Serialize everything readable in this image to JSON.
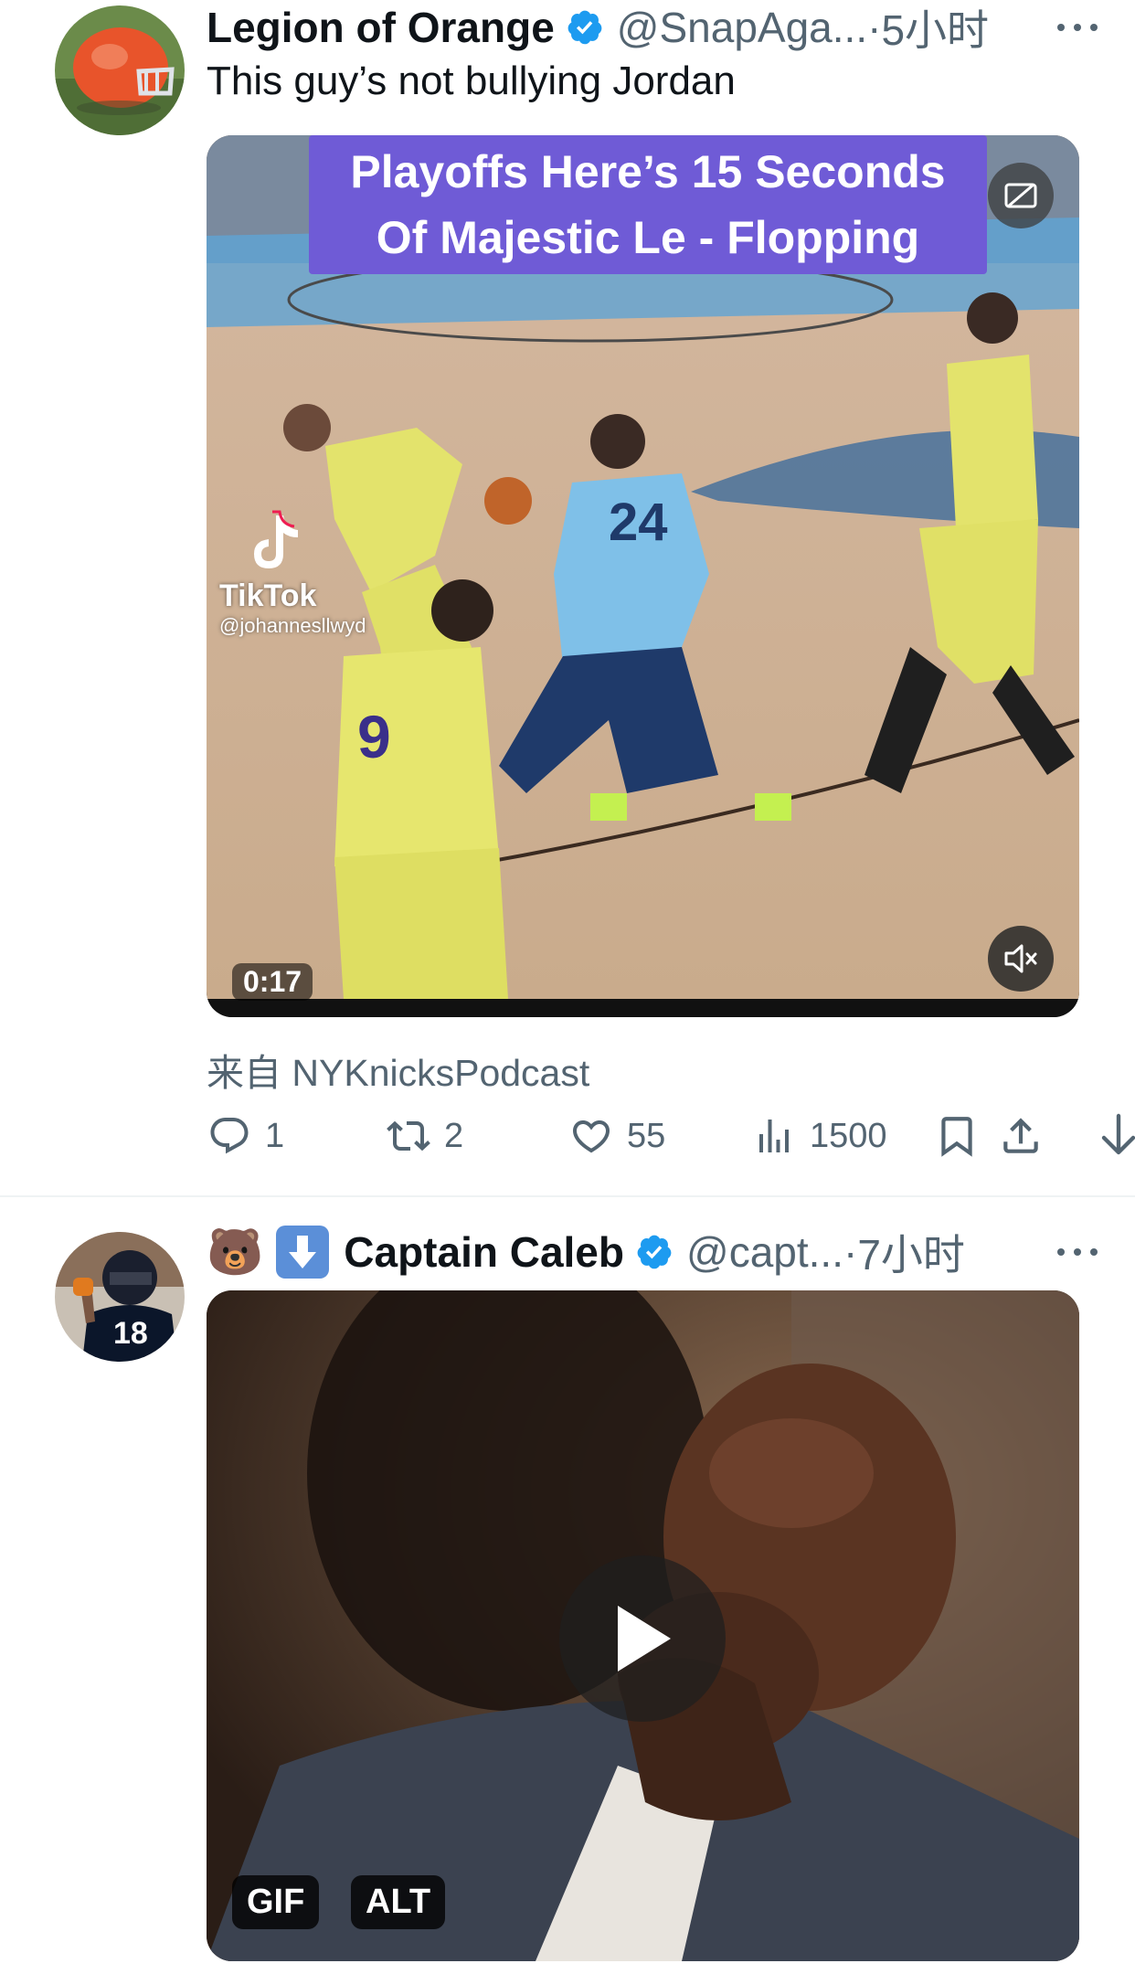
{
  "tweets": [
    {
      "author_name": "Legion of Orange",
      "handle": "@SnapAga...",
      "time_sep": " · ",
      "time": "5小时",
      "text": "This guy’s not bullying Jordan",
      "media": {
        "banner_line1": "Playoffs Here’s 15 Seconds",
        "banner_line2": "Of Majestic Le - Flopping",
        "watermark_brand": "TikTok",
        "watermark_user": "@johannesllwyd",
        "jersey_number_blue": "24",
        "jersey_number_yellow": "9",
        "duration": "0:17"
      },
      "source": "来自 NYKnicksPodcast",
      "actions": {
        "replies": "1",
        "retweets": "2",
        "likes": "55",
        "views": "1500"
      }
    },
    {
      "emoji_prefix": "🐻",
      "author_name": "Captain Caleb",
      "handle": "@capt...",
      "time_sep": " · ",
      "time": "7小时",
      "avatar_jersey": "18",
      "media": {
        "gif_label": "GIF",
        "alt_label": "ALT"
      }
    }
  ],
  "colors": {
    "verified": "#1d9bf0",
    "secondary_text": "#536471",
    "banner_purple": "#6f5bd6",
    "emoji_blue": "#5b8fd8"
  },
  "icons": [
    "more-icon",
    "reply-icon",
    "retweet-icon",
    "like-icon",
    "views-icon",
    "bookmark-icon",
    "share-icon",
    "download-icon",
    "mute-icon",
    "play-icon",
    "verified-icon",
    "down-arrow-emoji-icon"
  ]
}
